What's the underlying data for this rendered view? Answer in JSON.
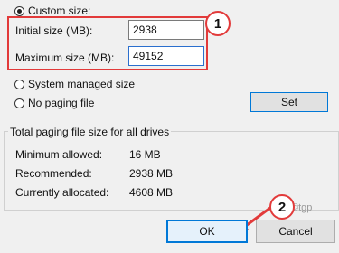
{
  "custom_size": {
    "label": "Custom size:",
    "selected": true
  },
  "initial_size": {
    "label": "Initial size (MB):",
    "value": "2938"
  },
  "maximum_size": {
    "label": "Maximum size (MB):",
    "value": "49152"
  },
  "system_managed": {
    "label": "System managed size",
    "selected": false
  },
  "no_paging": {
    "label": "No paging file",
    "selected": false
  },
  "set_button": {
    "label": "Set"
  },
  "totals": {
    "title": "Total paging file size for all drives",
    "rows": [
      {
        "label": "Minimum allowed:",
        "value": "16 MB"
      },
      {
        "label": "Recommended:",
        "value": "2938 MB"
      },
      {
        "label": "Currently allocated:",
        "value": "4608 MB"
      }
    ]
  },
  "ok_button": {
    "label": "OK"
  },
  "cancel_button": {
    "label": "Cancel"
  },
  "annotations": {
    "step1": "1",
    "step2": "2",
    "arrow_color": "#e23a3a"
  },
  "watermark": "©tgp"
}
